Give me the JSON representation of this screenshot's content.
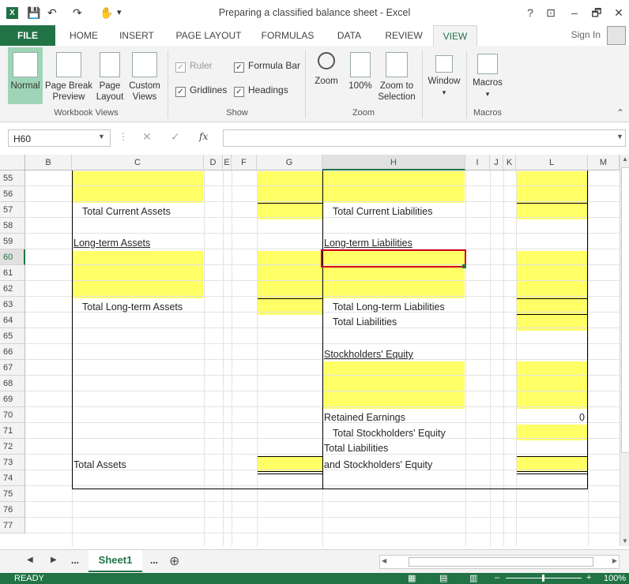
{
  "window": {
    "title": "Preparing a classified balance sheet - Excel",
    "help": "?",
    "controls": [
      "⊡",
      "–",
      "🗗",
      "✕"
    ]
  },
  "tabs": [
    {
      "label": "FILE"
    },
    {
      "label": "HOME"
    },
    {
      "label": "INSERT"
    },
    {
      "label": "PAGE LAYOUT"
    },
    {
      "label": "FORMULAS"
    },
    {
      "label": "DATA"
    },
    {
      "label": "REVIEW"
    },
    {
      "label": "VIEW"
    }
  ],
  "account": {
    "sign_in": "Sign In"
  },
  "ribbon": {
    "workbook_views": {
      "label": "Workbook Views",
      "normal": "Normal",
      "page_break_1": "Page Break",
      "page_break_2": "Preview",
      "page_layout_1": "Page",
      "page_layout_2": "Layout",
      "custom_1": "Custom",
      "custom_2": "Views"
    },
    "show": {
      "label": "Show",
      "ruler": "Ruler",
      "formula_bar": "Formula Bar",
      "gridlines": "Gridlines",
      "headings": "Headings"
    },
    "zoom": {
      "label": "Zoom",
      "zoom": "Zoom",
      "hundred": "100%",
      "selection_1": "Zoom to",
      "selection_2": "Selection"
    },
    "window": {
      "label": "Window"
    },
    "macros": {
      "label": "Macros",
      "button": "Macros"
    }
  },
  "formula_bar": {
    "name_box": "H60",
    "fx": "fx",
    "cancel": "✕",
    "enter": "✓"
  },
  "columns": [
    "B",
    "C",
    "D",
    "E",
    "F",
    "G",
    "H",
    "I",
    "J",
    "K",
    "L",
    "M"
  ],
  "rows": [
    "55",
    "56",
    "57",
    "58",
    "59",
    "60",
    "61",
    "62",
    "63",
    "64",
    "65",
    "66",
    "67",
    "68",
    "69",
    "70",
    "71",
    "72",
    "73",
    "74",
    "75",
    "76",
    "77"
  ],
  "cells": {
    "total_current_assets": "Total Current Assets",
    "total_current_liabilities": "Total Current Liabilities",
    "long_term_assets": "Long-term Assets",
    "long_term_liabilities": "Long-term Liabilities",
    "total_long_term_assets": "Total Long-term Assets",
    "total_long_term_liabilities": "Total Long-term Liabilities",
    "total_liabilities": "Total Liabilities",
    "stockholders_equity": "Stockholders' Equity",
    "retained_earnings": "Retained Earnings",
    "retained_earnings_value": "0",
    "total_stockholders_equity": "Total Stockholders' Equity",
    "total_liabilities_2": "Total Liabilities",
    "and_stockholders_equity": "and Stockholders' Equity",
    "total_assets": "Total Assets"
  },
  "sheets": {
    "ellipsis_left": "...",
    "active": "Sheet1",
    "ellipsis_right": "...",
    "add": "⊕"
  },
  "status": {
    "ready": "READY",
    "zoom": "100%"
  },
  "colors": {
    "brand": "#217346",
    "highlight": "#ffff66"
  }
}
